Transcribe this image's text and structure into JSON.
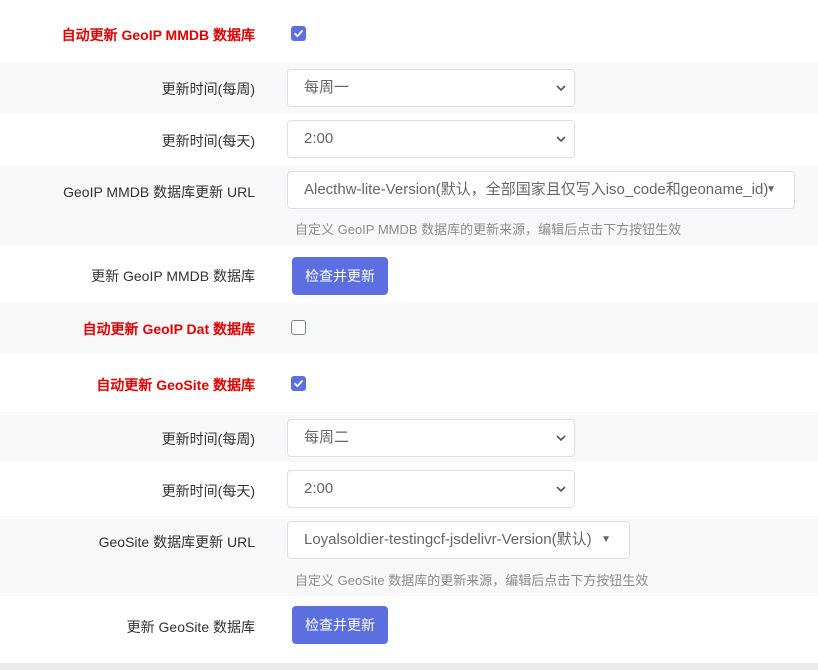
{
  "geoip_mmdb_auto": {
    "label": "自动更新 GeoIP MMDB 数据库",
    "checked": true
  },
  "geoip_weekly": {
    "label": "更新时间(每周)",
    "value": "每周一"
  },
  "geoip_daily": {
    "label": "更新时间(每天)",
    "value": "2:00"
  },
  "geoip_url": {
    "label": "GeoIP MMDB 数据库更新 URL",
    "value": "Alecthw-lite-Version(默认，全部国家且仅写入iso_code和geoname_id)",
    "hint": "自定义 GeoIP MMDB 数据库的更新来源，编辑后点击下方按钮生效"
  },
  "geoip_update": {
    "label": "更新 GeoIP MMDB 数据库",
    "button": "检查并更新"
  },
  "geoip_dat_auto": {
    "label": "自动更新 GeoIP Dat 数据库",
    "checked": false
  },
  "geosite_auto": {
    "label": "自动更新 GeoSite 数据库",
    "checked": true
  },
  "geosite_weekly": {
    "label": "更新时间(每周)",
    "value": "每周二"
  },
  "geosite_daily": {
    "label": "更新时间(每天)",
    "value": "2:00"
  },
  "geosite_url": {
    "label": "GeoSite 数据库更新 URL",
    "value": "Loyalsoldier-testingcf-jsdelivr-Version(默认)",
    "hint": "自定义 GeoSite 数据库的更新来源，编辑后点击下方按钮生效"
  },
  "geosite_update": {
    "label": "更新 GeoSite 数据库",
    "button": "检查并更新"
  },
  "colors": {
    "accent": "#5b6fe0",
    "required_label": "#e00000"
  }
}
